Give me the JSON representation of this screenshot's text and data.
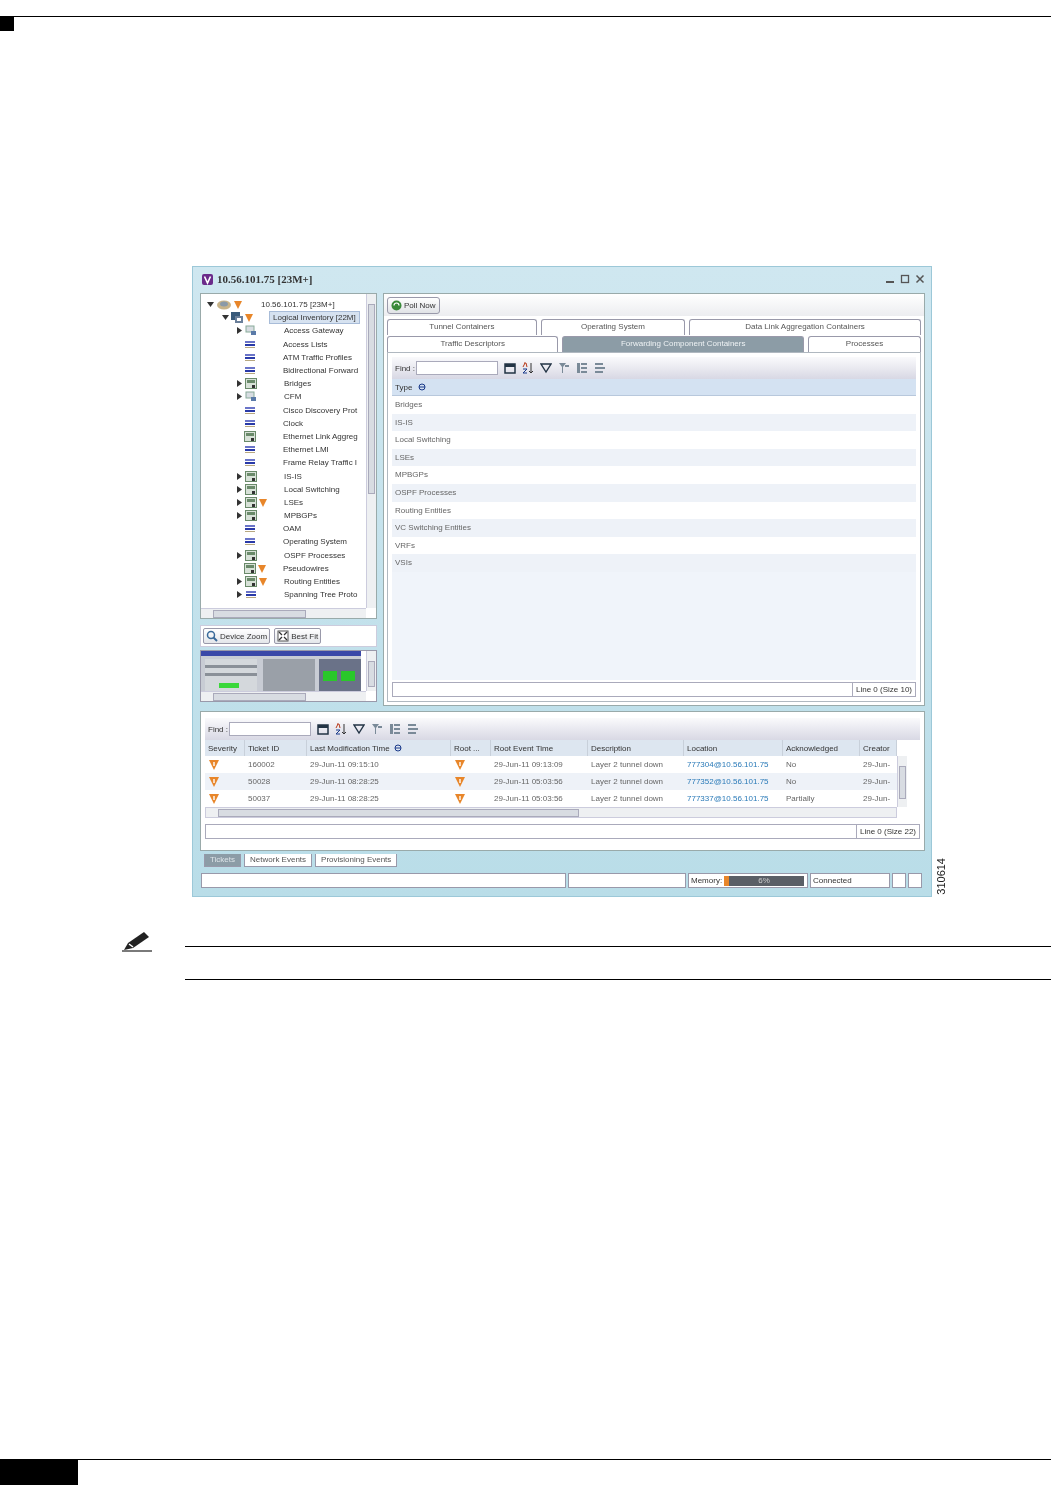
{
  "window": {
    "title": "10.56.101.75 [23M+]"
  },
  "tree": [
    {
      "label": "10.56.101.75 [23M+]",
      "kind": "device",
      "expandable": true,
      "expanded": true,
      "alarm": true,
      "selected": false,
      "children": [
        {
          "label": "Logical Inventory [22M]",
          "kind": "inventory",
          "expandable": true,
          "expanded": true,
          "alarm": true,
          "selected": true,
          "children": [
            {
              "label": "Access Gateway",
              "kind": "gateway",
              "expandable": true,
              "expanded": false,
              "alarm": false,
              "selected": false
            },
            {
              "label": "Access Lists",
              "kind": "list",
              "expandable": false,
              "alarm": false,
              "selected": false
            },
            {
              "label": "ATM Traffic Profiles",
              "kind": "list",
              "expandable": false,
              "alarm": false,
              "selected": false
            },
            {
              "label": "Bidirectional Forward",
              "kind": "list",
              "expandable": false,
              "alarm": false,
              "selected": false
            },
            {
              "label": "Bridges",
              "kind": "container",
              "expandable": true,
              "expanded": false,
              "alarm": false,
              "selected": false
            },
            {
              "label": "CFM",
              "kind": "gateway",
              "expandable": true,
              "expanded": false,
              "alarm": false,
              "selected": false
            },
            {
              "label": "Cisco Discovery Prot",
              "kind": "list",
              "expandable": false,
              "alarm": false,
              "selected": false
            },
            {
              "label": "Clock",
              "kind": "list",
              "expandable": false,
              "alarm": false,
              "selected": false
            },
            {
              "label": "Ethernet Link Aggreg",
              "kind": "container",
              "expandable": false,
              "alarm": false,
              "selected": false
            },
            {
              "label": "Ethernet LMI",
              "kind": "list",
              "expandable": false,
              "alarm": false,
              "selected": false
            },
            {
              "label": "Frame Relay Traffic I",
              "kind": "list",
              "expandable": false,
              "alarm": false,
              "selected": false
            },
            {
              "label": "IS-IS",
              "kind": "container",
              "expandable": true,
              "expanded": false,
              "alarm": false,
              "selected": false
            },
            {
              "label": "Local Switching",
              "kind": "container",
              "expandable": true,
              "expanded": false,
              "alarm": false,
              "selected": false
            },
            {
              "label": "LSEs",
              "kind": "container",
              "expandable": true,
              "expanded": false,
              "alarm": true,
              "selected": false
            },
            {
              "label": "MPBGPs",
              "kind": "container",
              "expandable": true,
              "expanded": false,
              "alarm": false,
              "selected": false
            },
            {
              "label": "OAM",
              "kind": "list",
              "expandable": false,
              "alarm": false,
              "selected": false
            },
            {
              "label": "Operating System",
              "kind": "list",
              "expandable": false,
              "alarm": false,
              "selected": false
            },
            {
              "label": "OSPF Processes",
              "kind": "container",
              "expandable": true,
              "expanded": false,
              "alarm": false,
              "selected": false
            },
            {
              "label": "Pseudowires",
              "kind": "container",
              "expandable": false,
              "alarm": true,
              "selected": false
            },
            {
              "label": "Routing Entities",
              "kind": "container",
              "expandable": true,
              "expanded": false,
              "alarm": true,
              "selected": false
            },
            {
              "label": "Spanning Tree Proto",
              "kind": "list",
              "expandable": true,
              "expanded": false,
              "alarm": false,
              "selected": false
            }
          ]
        }
      ]
    }
  ],
  "device_toolbar": [
    "Device Zoom",
    "Best Fit"
  ],
  "poll_button": "Poll Now",
  "tab_rows": [
    [
      {
        "label": "Tunnel Containers",
        "selected": false
      },
      {
        "label": "Operating System",
        "selected": false
      },
      {
        "label": "Data Link Aggregation Containers",
        "selected": false
      }
    ],
    [
      {
        "label": "Traffic Descriptors",
        "selected": false
      },
      {
        "label": "Forwarding Component Containers",
        "selected": true
      },
      {
        "label": "Processes",
        "selected": false
      }
    ]
  ],
  "containers_table": {
    "find_label": "Find :",
    "columns": [
      {
        "label": "Type",
        "sorted": true
      }
    ],
    "rows": [
      "Bridges",
      "IS-IS",
      "Local Switching",
      "LSEs",
      "MPBGPs",
      "OSPF Processes",
      "Routing Entities",
      "VC Switching Entities",
      "VRFs",
      "VSIs"
    ],
    "footer": "Line 0 (Size 10)"
  },
  "tickets_table": {
    "find_label": "Find :",
    "columns": [
      {
        "label": "Severity",
        "kind": "severity",
        "sorted": false
      },
      {
        "label": "Ticket ID",
        "kind": "text",
        "sorted": false
      },
      {
        "label": "Last Modification Time",
        "kind": "text",
        "sorted": true
      },
      {
        "label": "Root ...",
        "kind": "root",
        "sorted": false
      },
      {
        "label": "Root Event Time",
        "kind": "text",
        "sorted": false
      },
      {
        "label": "Description",
        "kind": "text",
        "sorted": false
      },
      {
        "label": "Location",
        "kind": "link",
        "sorted": false
      },
      {
        "label": "Acknowledged",
        "kind": "text",
        "sorted": false
      },
      {
        "label": "Creator",
        "kind": "text",
        "sorted": false
      }
    ],
    "rows": [
      {
        "cells": [
          "",
          "160002",
          "29-Jun-11 09:15:10",
          "",
          "29-Jun-11 09:13:09",
          "Layer 2 tunnel down",
          "777304@10.56.101.75",
          "No",
          "29-Jun-"
        ]
      },
      {
        "cells": [
          "",
          "50028",
          "29-Jun-11 08:28:25",
          "",
          "29-Jun-11 05:03:56",
          "Layer 2 tunnel down",
          "777352@10.56.101.75",
          "No",
          "29-Jun-"
        ]
      },
      {
        "cells": [
          "",
          "50037",
          "29-Jun-11 08:28:25",
          "",
          "29-Jun-11 05:03:56",
          "Layer 2 tunnel down",
          "777337@10.56.101.75",
          "Partially",
          "29-Jun-"
        ]
      }
    ],
    "footer": "Line 0 (Size 22)"
  },
  "bottom_tabs": [
    {
      "label": "Tickets",
      "selected": true
    },
    {
      "label": "Network Events",
      "selected": false
    },
    {
      "label": "Provisioning Events",
      "selected": false
    }
  ],
  "status_bar": {
    "memory": {
      "label": "Memory:",
      "level": 0.06,
      "reading": "6%"
    },
    "connection": "Connected"
  },
  "figure_number": "310614"
}
